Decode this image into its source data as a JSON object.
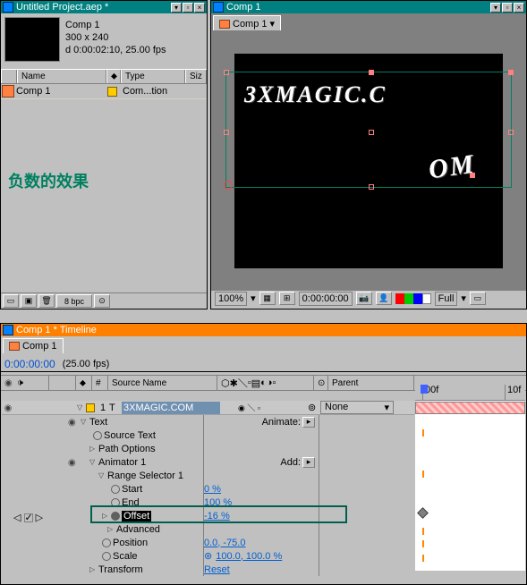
{
  "project_panel": {
    "title": "Untitled Project.aep *",
    "comp_name": "Comp 1",
    "dimensions": "300 x 240",
    "duration": "d 0:00:02:10, 25.00 fps",
    "columns": {
      "name": "Name",
      "type": "Type",
      "size": "Siz"
    },
    "items": [
      {
        "name": "Comp 1",
        "type": "Com...tion"
      }
    ],
    "bpc": "8 bpc"
  },
  "comment": "负数的效果",
  "viewer_panel": {
    "title": "Comp 1",
    "tab": "Comp 1",
    "preview_text_main": "3XMAGIC.C",
    "preview_text_sub": "OM",
    "zoom": "100%",
    "timecode": "0:00:00:00",
    "res": "Full"
  },
  "timeline_panel": {
    "title": "Comp 1 * Timeline",
    "tab": "Comp 1",
    "timecode": "0:00:00:00",
    "fps": "(25.00 fps)",
    "columns": {
      "num": "#",
      "source": "Source Name",
      "parent": "Parent"
    },
    "layer": {
      "num": "1",
      "name": "3XMAGIC.COM",
      "parent": "None"
    },
    "ruler": {
      "start": "00f",
      "mark1": "10f"
    },
    "props": {
      "text": "Text",
      "animate": "Animate:",
      "source_text": "Source Text",
      "path_options": "Path Options",
      "animator": "Animator 1",
      "add": "Add:",
      "range_selector": "Range Selector 1",
      "start": {
        "label": "Start",
        "value": "0 %"
      },
      "end": {
        "label": "End",
        "value": "100 %"
      },
      "offset": {
        "label": "Offset",
        "value": "-16 %"
      },
      "advanced": "Advanced",
      "position": {
        "label": "Position",
        "value": "0.0, -75.0"
      },
      "scale": {
        "label": "Scale",
        "value": "100.0, 100.0 %"
      },
      "scale_link": "⊛",
      "transform": "Transform",
      "reset": "Reset"
    }
  },
  "colors": {
    "teal": "#008080",
    "orange": "#ff7f00",
    "highlight": "#006050",
    "link": "#0060d0"
  }
}
